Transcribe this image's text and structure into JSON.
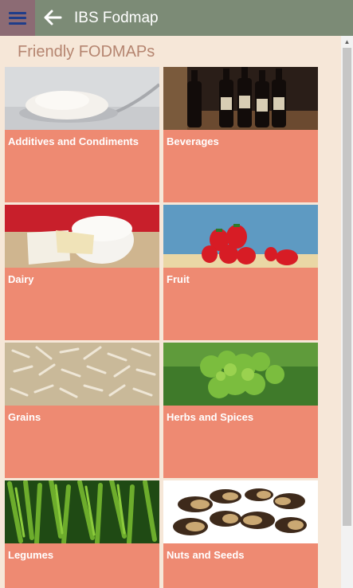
{
  "appbar": {
    "title": "IBS Fodmap",
    "menu_icon": "hamburger-menu-icon",
    "back_icon": "back-arrow-icon"
  },
  "page": {
    "title": "Friendly FODMAPs"
  },
  "categories": [
    {
      "label": "Additives and Condiments",
      "image": "sugar-spoon-photo"
    },
    {
      "label": "Beverages",
      "image": "wine-bottles-photo"
    },
    {
      "label": "Dairy",
      "image": "brie-cheese-photo"
    },
    {
      "label": "Fruit",
      "image": "strawberries-photo"
    },
    {
      "label": "Grains",
      "image": "rice-grains-photo"
    },
    {
      "label": "Herbs and Spices",
      "image": "parsley-photo"
    },
    {
      "label": "Legumes",
      "image": "green-beans-photo"
    },
    {
      "label": "Nuts and Seeds",
      "image": "brazil-nuts-photo"
    }
  ],
  "colors": {
    "appbar": "#7c8b76",
    "menu_button": "#8c6b74",
    "tile": "#ee8a72",
    "background": "#f6e7d8",
    "page_title": "#b58570"
  }
}
